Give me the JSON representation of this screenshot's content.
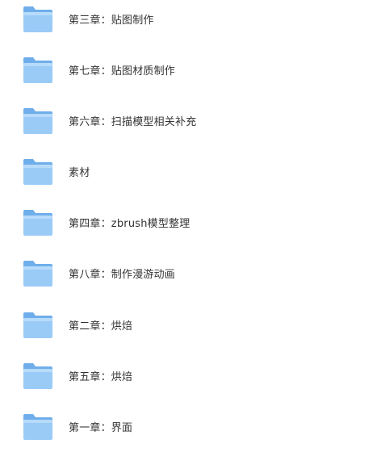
{
  "colors": {
    "folder_back": "#6FAEEB",
    "folder_front": "#9ACBF7",
    "folder_front_top": "#B7DBFA",
    "text": "#333333"
  },
  "items": [
    {
      "label": "第三章：贴图制作",
      "icon": "folder-icon"
    },
    {
      "label": "第七章：贴图材质制作",
      "icon": "folder-icon"
    },
    {
      "label": "第六章：扫描模型相关补充",
      "icon": "folder-icon"
    },
    {
      "label": "素材",
      "icon": "folder-icon"
    },
    {
      "label": "第四章：zbrush模型整理",
      "icon": "folder-icon"
    },
    {
      "label": "第八章：制作漫游动画",
      "icon": "folder-icon"
    },
    {
      "label": "第二章：烘焙",
      "icon": "folder-icon"
    },
    {
      "label": "第五章：烘焙",
      "icon": "folder-icon"
    },
    {
      "label": "第一章：界面",
      "icon": "folder-icon"
    }
  ]
}
